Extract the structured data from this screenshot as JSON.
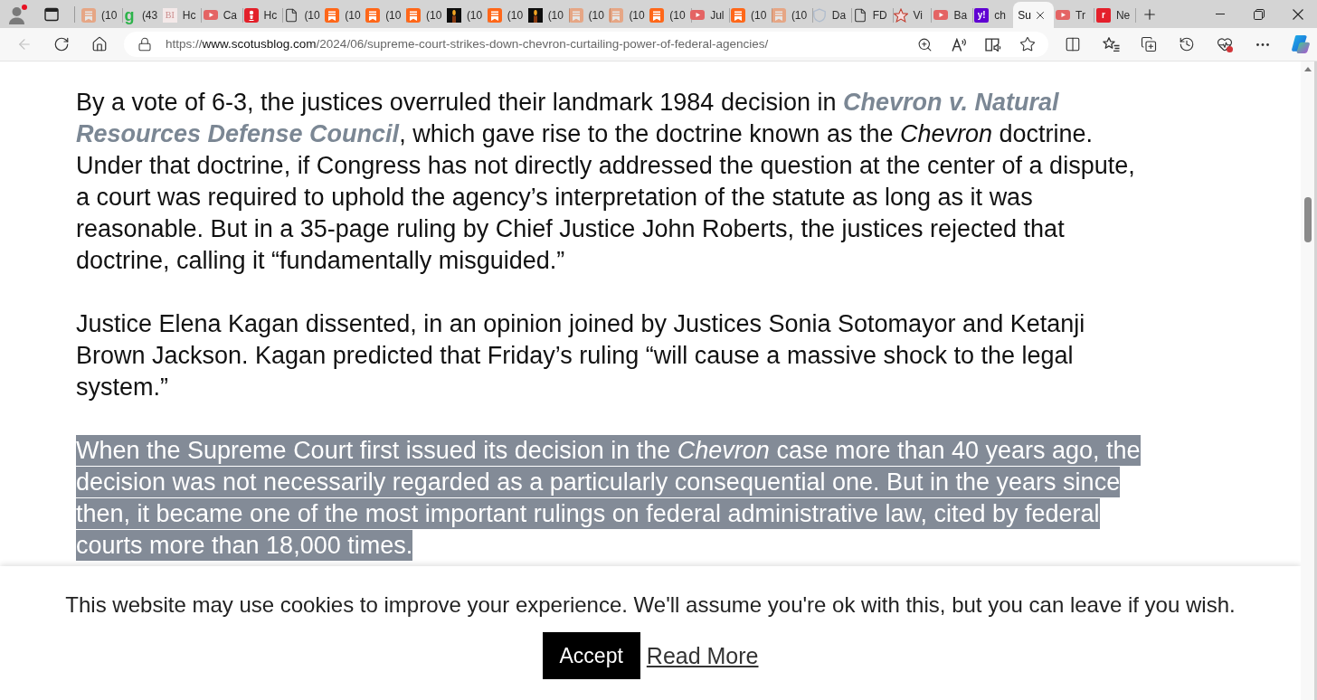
{
  "tabs": [
    {
      "title": "(10",
      "kind": "bookmark",
      "sleeping": true,
      "selected": false
    },
    {
      "title": "(43",
      "kind": "glyph",
      "glyph": "g",
      "color": "#2db34a",
      "sleeping": false,
      "selected": false
    },
    {
      "title": "Hc",
      "kind": "serif-glyph",
      "glyph": "BI",
      "color": "#c98b8b",
      "sleeping": false,
      "selected": false
    },
    {
      "title": "Ca",
      "kind": "video",
      "sleeping": false,
      "selected": false
    },
    {
      "title": "Hc",
      "kind": "alert",
      "sleeping": false,
      "selected": false
    },
    {
      "title": "(10",
      "kind": "page",
      "sleeping": false,
      "selected": false
    },
    {
      "title": "(10",
      "kind": "bookmark",
      "sleeping": false,
      "selected": false
    },
    {
      "title": "(10",
      "kind": "bookmark",
      "sleeping": false,
      "selected": false
    },
    {
      "title": "(10",
      "kind": "bookmark",
      "sleeping": false,
      "selected": false
    },
    {
      "title": "(10",
      "kind": "candle",
      "sleeping": false,
      "selected": false
    },
    {
      "title": "(10",
      "kind": "bookmark",
      "sleeping": false,
      "selected": false
    },
    {
      "title": "(10",
      "kind": "candle",
      "sleeping": false,
      "selected": false
    },
    {
      "title": "(10",
      "kind": "bookmark",
      "sleeping": true,
      "selected": false
    },
    {
      "title": "(10",
      "kind": "bookmark",
      "sleeping": true,
      "selected": false
    },
    {
      "title": "(10",
      "kind": "bookmark",
      "sleeping": false,
      "selected": false
    },
    {
      "title": "Jul",
      "kind": "video",
      "sleeping": false,
      "selected": false
    },
    {
      "title": "(10",
      "kind": "bookmark",
      "sleeping": false,
      "selected": false
    },
    {
      "title": "(10",
      "kind": "bookmark",
      "sleeping": true,
      "selected": false
    },
    {
      "title": "Da",
      "kind": "shield",
      "sleeping": true,
      "selected": false
    },
    {
      "title": "FD",
      "kind": "page",
      "sleeping": false,
      "selected": false
    },
    {
      "title": "Vi",
      "kind": "star",
      "sleeping": false,
      "selected": false
    },
    {
      "title": "Ba",
      "kind": "video",
      "sleeping": false,
      "selected": false
    },
    {
      "title": "ch",
      "kind": "glyph-tile",
      "glyph": "y!",
      "color": "#6001d2",
      "sleeping": false,
      "selected": false
    },
    {
      "title": "Su",
      "selected": true
    },
    {
      "title": "Tr",
      "kind": "video",
      "sleeping": false,
      "selected": false
    },
    {
      "title": "Ne",
      "kind": "glyph-tile",
      "glyph": "r",
      "color": "#e4202b",
      "sleeping": false,
      "selected": false
    }
  ],
  "toolbar": {
    "back": {
      "disabled": true
    },
    "url": {
      "scheme": "https://",
      "host": "www.scotusblog.com",
      "path": "/2024/06/supreme-court-strikes-down-chevron-curtailing-power-of-federal-agencies/"
    }
  },
  "article": {
    "paragraphs": [
      {
        "highlighted": false,
        "parts": [
          {
            "kind": "text",
            "text": "By a vote of 6-3, the justices overruled their landmark 1984 decision in "
          },
          {
            "kind": "link",
            "text": "Chevron v. Natural Resources Defense Council"
          },
          {
            "kind": "text",
            "text": ", which gave rise to the doctrine known as the *Chevron* doctrine. Under that doctrine, if Congress has not directly addressed the question at the center of a dispute, a court was required to uphold the agency’s interpretation of the statute as long as it was reasonable. But in a 35-page ruling by Chief Justice John Roberts, the justices rejected that doctrine, calling it “fundamentally misguided.”"
          }
        ]
      },
      {
        "highlighted": false,
        "parts": [
          {
            "kind": "text",
            "text": "Justice Elena Kagan dissented, in an opinion joined by Justices Sonia Sotomayor and Ketanji Brown Jackson. Kagan predicted that Friday’s ruling “will cause a massive shock to the legal system.”"
          }
        ]
      },
      {
        "highlighted": true,
        "parts": [
          {
            "kind": "text",
            "text": "When the Supreme Court first issued its decision in the *Chevron* case more than 40 years ago, the decision was not necessarily regarded as a particularly consequential one. But in the years since then, it became one of the most important rulings on federal administrative law, cited by federal courts more than 18,000 times."
          }
        ]
      }
    ]
  },
  "cookie_banner": {
    "message": "This website may use cookies to improve your experience. We'll assume you're ok with this, but you can leave if you wish.",
    "accept_button": "Accept",
    "read_more_link": "Read More"
  }
}
